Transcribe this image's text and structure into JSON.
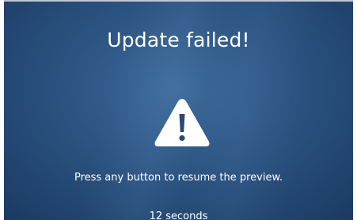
{
  "dialog": {
    "title": "Update failed!",
    "icon": "warning-icon",
    "message": "Press any button to resume the preview.",
    "countdown": "12 seconds"
  },
  "colors": {
    "background_center": "#3d6a9a",
    "background_edge": "#1a3a62",
    "text": "#ffffff",
    "icon_fill": "#ffffff",
    "icon_mark": "#2c4a70"
  }
}
